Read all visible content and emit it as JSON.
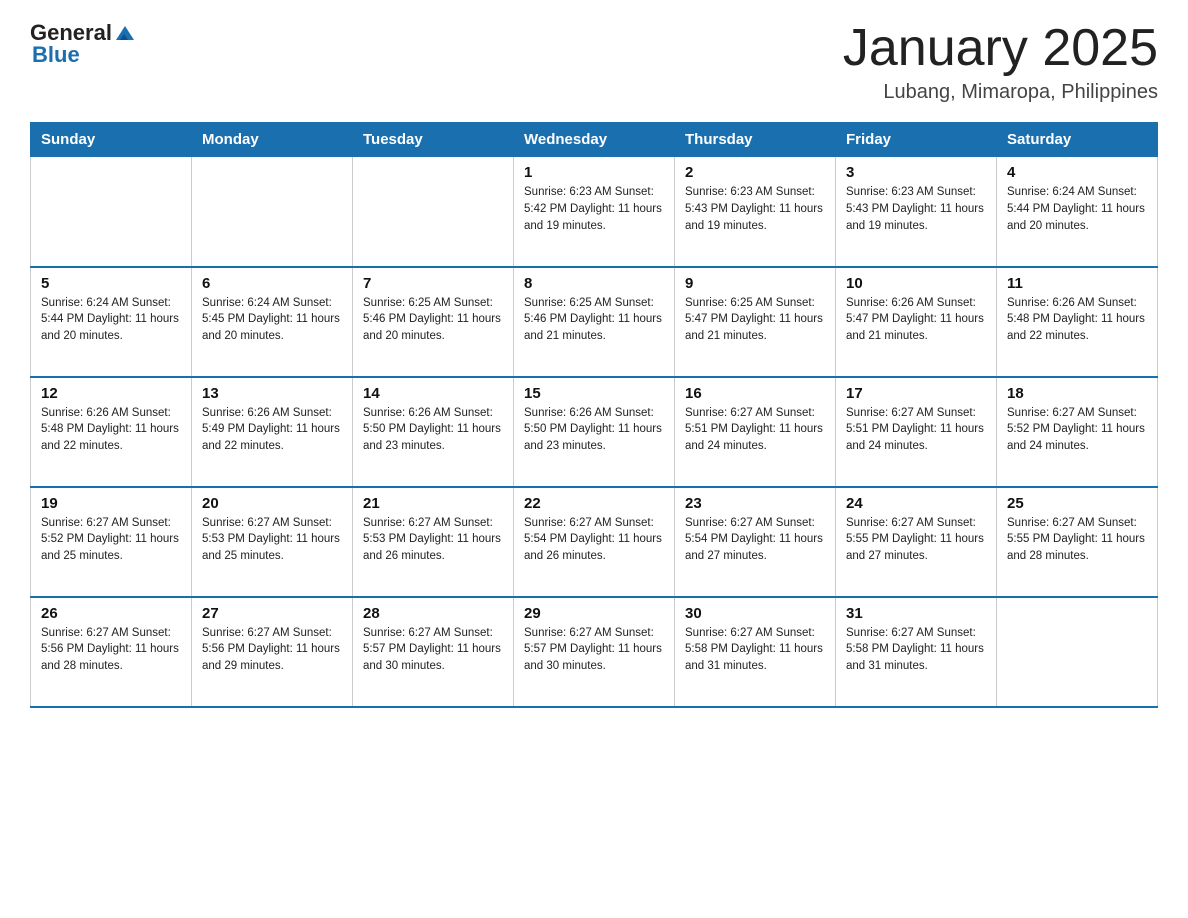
{
  "header": {
    "logo_general": "General",
    "logo_blue": "Blue",
    "title": "January 2025",
    "subtitle": "Lubang, Mimaropa, Philippines"
  },
  "days_of_week": [
    "Sunday",
    "Monday",
    "Tuesday",
    "Wednesday",
    "Thursday",
    "Friday",
    "Saturday"
  ],
  "weeks": [
    [
      {
        "day": "",
        "info": ""
      },
      {
        "day": "",
        "info": ""
      },
      {
        "day": "",
        "info": ""
      },
      {
        "day": "1",
        "info": "Sunrise: 6:23 AM\nSunset: 5:42 PM\nDaylight: 11 hours and 19 minutes."
      },
      {
        "day": "2",
        "info": "Sunrise: 6:23 AM\nSunset: 5:43 PM\nDaylight: 11 hours and 19 minutes."
      },
      {
        "day": "3",
        "info": "Sunrise: 6:23 AM\nSunset: 5:43 PM\nDaylight: 11 hours and 19 minutes."
      },
      {
        "day": "4",
        "info": "Sunrise: 6:24 AM\nSunset: 5:44 PM\nDaylight: 11 hours and 20 minutes."
      }
    ],
    [
      {
        "day": "5",
        "info": "Sunrise: 6:24 AM\nSunset: 5:44 PM\nDaylight: 11 hours and 20 minutes."
      },
      {
        "day": "6",
        "info": "Sunrise: 6:24 AM\nSunset: 5:45 PM\nDaylight: 11 hours and 20 minutes."
      },
      {
        "day": "7",
        "info": "Sunrise: 6:25 AM\nSunset: 5:46 PM\nDaylight: 11 hours and 20 minutes."
      },
      {
        "day": "8",
        "info": "Sunrise: 6:25 AM\nSunset: 5:46 PM\nDaylight: 11 hours and 21 minutes."
      },
      {
        "day": "9",
        "info": "Sunrise: 6:25 AM\nSunset: 5:47 PM\nDaylight: 11 hours and 21 minutes."
      },
      {
        "day": "10",
        "info": "Sunrise: 6:26 AM\nSunset: 5:47 PM\nDaylight: 11 hours and 21 minutes."
      },
      {
        "day": "11",
        "info": "Sunrise: 6:26 AM\nSunset: 5:48 PM\nDaylight: 11 hours and 22 minutes."
      }
    ],
    [
      {
        "day": "12",
        "info": "Sunrise: 6:26 AM\nSunset: 5:48 PM\nDaylight: 11 hours and 22 minutes."
      },
      {
        "day": "13",
        "info": "Sunrise: 6:26 AM\nSunset: 5:49 PM\nDaylight: 11 hours and 22 minutes."
      },
      {
        "day": "14",
        "info": "Sunrise: 6:26 AM\nSunset: 5:50 PM\nDaylight: 11 hours and 23 minutes."
      },
      {
        "day": "15",
        "info": "Sunrise: 6:26 AM\nSunset: 5:50 PM\nDaylight: 11 hours and 23 minutes."
      },
      {
        "day": "16",
        "info": "Sunrise: 6:27 AM\nSunset: 5:51 PM\nDaylight: 11 hours and 24 minutes."
      },
      {
        "day": "17",
        "info": "Sunrise: 6:27 AM\nSunset: 5:51 PM\nDaylight: 11 hours and 24 minutes."
      },
      {
        "day": "18",
        "info": "Sunrise: 6:27 AM\nSunset: 5:52 PM\nDaylight: 11 hours and 24 minutes."
      }
    ],
    [
      {
        "day": "19",
        "info": "Sunrise: 6:27 AM\nSunset: 5:52 PM\nDaylight: 11 hours and 25 minutes."
      },
      {
        "day": "20",
        "info": "Sunrise: 6:27 AM\nSunset: 5:53 PM\nDaylight: 11 hours and 25 minutes."
      },
      {
        "day": "21",
        "info": "Sunrise: 6:27 AM\nSunset: 5:53 PM\nDaylight: 11 hours and 26 minutes."
      },
      {
        "day": "22",
        "info": "Sunrise: 6:27 AM\nSunset: 5:54 PM\nDaylight: 11 hours and 26 minutes."
      },
      {
        "day": "23",
        "info": "Sunrise: 6:27 AM\nSunset: 5:54 PM\nDaylight: 11 hours and 27 minutes."
      },
      {
        "day": "24",
        "info": "Sunrise: 6:27 AM\nSunset: 5:55 PM\nDaylight: 11 hours and 27 minutes."
      },
      {
        "day": "25",
        "info": "Sunrise: 6:27 AM\nSunset: 5:55 PM\nDaylight: 11 hours and 28 minutes."
      }
    ],
    [
      {
        "day": "26",
        "info": "Sunrise: 6:27 AM\nSunset: 5:56 PM\nDaylight: 11 hours and 28 minutes."
      },
      {
        "day": "27",
        "info": "Sunrise: 6:27 AM\nSunset: 5:56 PM\nDaylight: 11 hours and 29 minutes."
      },
      {
        "day": "28",
        "info": "Sunrise: 6:27 AM\nSunset: 5:57 PM\nDaylight: 11 hours and 30 minutes."
      },
      {
        "day": "29",
        "info": "Sunrise: 6:27 AM\nSunset: 5:57 PM\nDaylight: 11 hours and 30 minutes."
      },
      {
        "day": "30",
        "info": "Sunrise: 6:27 AM\nSunset: 5:58 PM\nDaylight: 11 hours and 31 minutes."
      },
      {
        "day": "31",
        "info": "Sunrise: 6:27 AM\nSunset: 5:58 PM\nDaylight: 11 hours and 31 minutes."
      },
      {
        "day": "",
        "info": ""
      }
    ]
  ]
}
